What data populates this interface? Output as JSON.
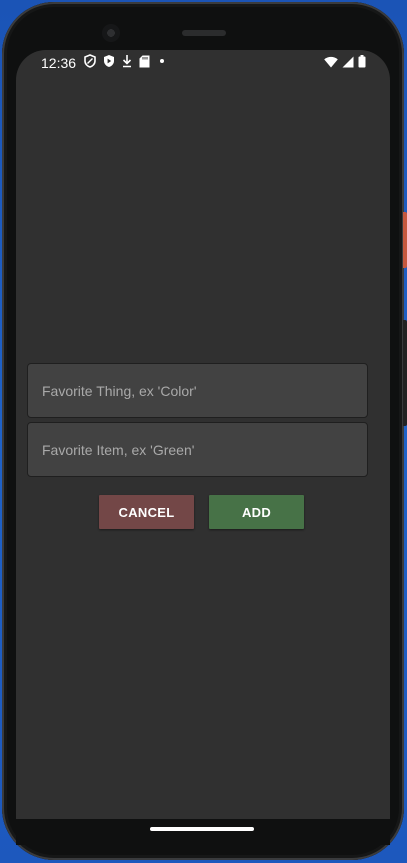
{
  "status_bar": {
    "time": "12:36",
    "left_icons": [
      "shield-outline-icon",
      "shield-play-icon",
      "download-arrow-icon",
      "sd-card-icon",
      "notification-dot-icon"
    ],
    "right_icons": [
      "wifi-icon",
      "cellular-signal-icon",
      "battery-icon"
    ]
  },
  "form": {
    "thing_placeholder": "Favorite Thing, ex 'Color'",
    "thing_value": "",
    "item_placeholder": "Favorite Item, ex 'Green'",
    "item_value": ""
  },
  "buttons": {
    "cancel_label": "Cancel",
    "add_label": "Add"
  },
  "colors": {
    "screen_background": "#303030",
    "field_background": "#424242",
    "cancel_button": "#734747",
    "add_button": "#477247"
  }
}
